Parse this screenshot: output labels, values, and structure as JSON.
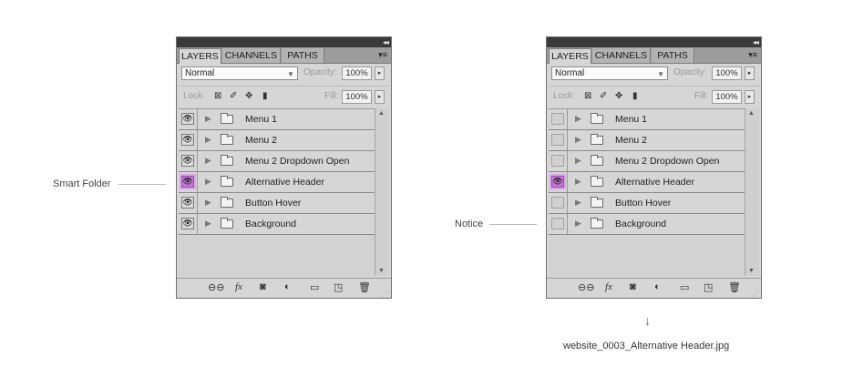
{
  "annotations": {
    "left_label": "Smart Folder",
    "right_label": "Notice",
    "arrow_icon": "arrow-down-icon",
    "filename": "website_0003_Alternative Header.jpg"
  },
  "panel": {
    "tabs": [
      "LAYERS",
      "CHANNELS",
      "PATHS"
    ],
    "blend_mode": "Normal",
    "opacity_label": "Opacity:",
    "opacity_value": "100%",
    "lock_label": "Lock:",
    "fill_label": "Fill:",
    "fill_value": "100%",
    "layers": [
      "Menu 1",
      "Menu 2",
      "Menu 2 Dropdown Open",
      "Alternative Header",
      "Button Hover",
      "Background"
    ]
  },
  "left_panel_visibility": [
    "on",
    "on",
    "on",
    "highlight",
    "on",
    "on"
  ],
  "right_panel_visibility": [
    "off",
    "off",
    "off",
    "highlight",
    "off",
    "off"
  ],
  "colors": {
    "highlight": "#c07ad0",
    "panel_bg": "#d6d6d6",
    "topbar": "#3a3a3a"
  }
}
